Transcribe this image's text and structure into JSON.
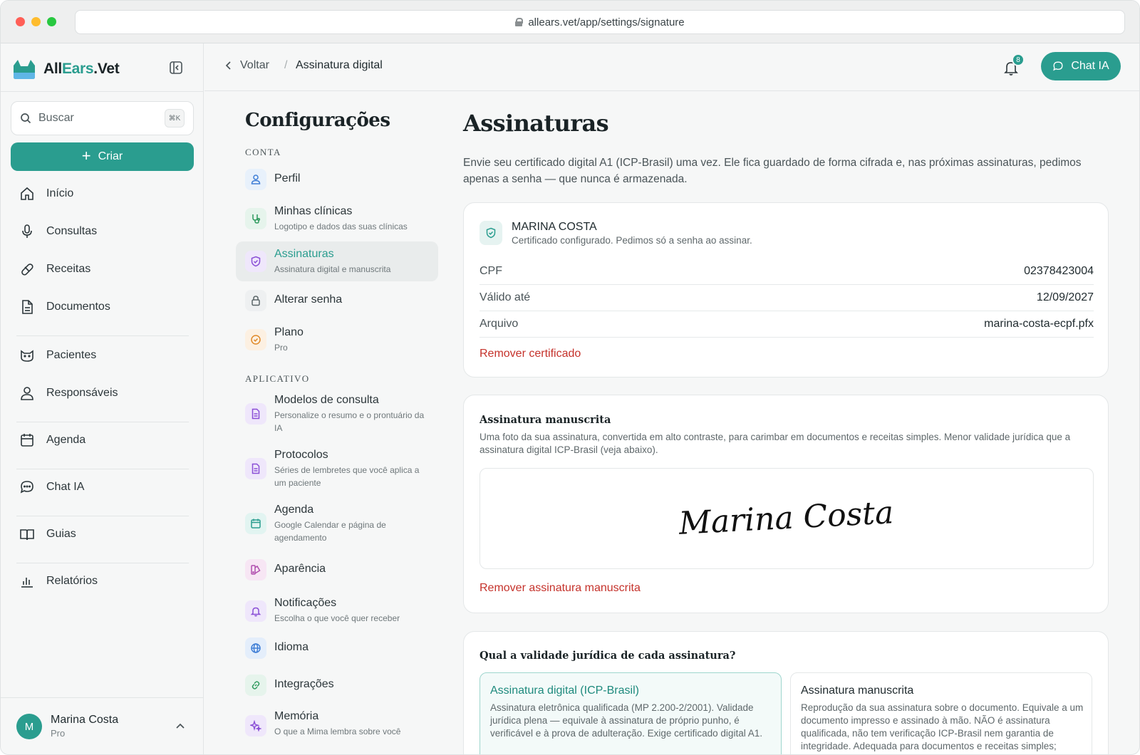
{
  "browser": {
    "url": "allears.vet/app/settings/signature"
  },
  "brand": {
    "part1": "All",
    "part2": "Ears",
    "part3": ".Vet"
  },
  "sidebar": {
    "search_placeholder": "Buscar",
    "search_shortcut": "⌘K",
    "create_label": "Criar",
    "nav": {
      "inicio": "Início",
      "consultas": "Consultas",
      "receitas": "Receitas",
      "documentos": "Documentos",
      "pacientes": "Pacientes",
      "responsaveis": "Responsáveis",
      "agenda": "Agenda",
      "chat": "Chat IA",
      "guias": "Guias",
      "relatorios": "Relatórios"
    },
    "user": {
      "initial": "M",
      "name": "Marina Costa",
      "plan": "Pro"
    }
  },
  "topbar": {
    "back_label": "Voltar",
    "separator": "/",
    "current": "Assinatura digital",
    "notifications_count": "8",
    "chat_label": "Chat IA"
  },
  "settings": {
    "title": "Configurações",
    "group_account": "CONTA",
    "group_app": "APLICATIVO",
    "items": {
      "perfil": {
        "label": "Perfil"
      },
      "clinicas": {
        "label": "Minhas clínicas",
        "sub": "Logotipo e dados das suas clínicas"
      },
      "assinaturas": {
        "label": "Assinaturas",
        "sub": "Assinatura digital e manuscrita"
      },
      "senha": {
        "label": "Alterar senha"
      },
      "plano": {
        "label": "Plano",
        "sub": "Pro"
      },
      "modelos": {
        "label": "Modelos de consulta",
        "sub": "Personalize o resumo e o prontuário da IA"
      },
      "protocolos": {
        "label": "Protocolos",
        "sub": "Séries de lembretes que você aplica a um paciente"
      },
      "agenda": {
        "label": "Agenda",
        "sub": "Google Calendar e página de agendamento"
      },
      "aparencia": {
        "label": "Aparência"
      },
      "notificacoes": {
        "label": "Notificações",
        "sub": "Escolha o que você quer receber"
      },
      "idioma": {
        "label": "Idioma"
      },
      "integracoes": {
        "label": "Integrações"
      },
      "memoria": {
        "label": "Memória",
        "sub": "O que a Mima lembra sobre você"
      }
    }
  },
  "content": {
    "title": "Assinaturas",
    "description": "Envie seu certificado digital A1 (ICP-Brasil) uma vez. Ele fica guardado de forma cifrada e, nas próximas assinaturas, pedimos apenas a senha — que nunca é armazenada.",
    "certificate": {
      "holder": "MARINA COSTA",
      "status": "Certificado configurado. Pedimos só a senha ao assinar.",
      "rows": [
        {
          "label": "CPF",
          "value": "02378423004"
        },
        {
          "label": "Válido até",
          "value": "12/09/2027"
        },
        {
          "label": "Arquivo",
          "value": "marina-costa-ecpf.pfx"
        }
      ],
      "remove_label": "Remover certificado"
    },
    "handwritten": {
      "title": "Assinatura manuscrita",
      "text": "Uma foto da sua assinatura, convertida em alto contraste, para carimbar em documentos e receitas simples. Menor validade jurídica que a assinatura digital ICP-Brasil (veja abaixo).",
      "signature_text": "Marina Costa",
      "remove_label": "Remover assinatura manuscrita"
    },
    "legal": {
      "title": "Qual a validade jurídica de cada assinatura?",
      "digital": {
        "heading": "Assinatura digital (ICP-Brasil)",
        "text": "Assinatura eletrônica qualificada (MP 2.200-2/2001). Validade jurídica plena — equivale à assinatura de próprio punho, é verificável e à prova de adulteração. Exige certificado digital A1."
      },
      "manual": {
        "heading": "Assinatura manuscrita",
        "text": "Reprodução da sua assinatura sobre o documento. Equivale a um documento impresso e assinado à mão. NÃO é assinatura qualificada, não tem verificação ICP-Brasil nem garantia de integridade. Adequada para documentos e receitas simples;"
      }
    }
  },
  "colors": {
    "accent": "#2a9d8f",
    "danger": "#c5322b"
  }
}
